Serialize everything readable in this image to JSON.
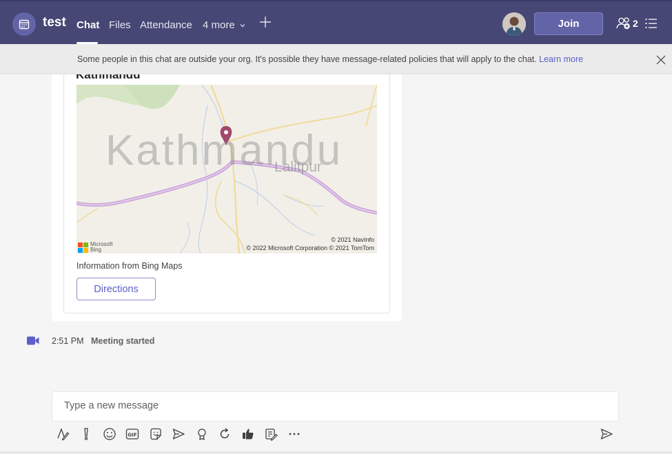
{
  "header": {
    "title": "test",
    "tabs": [
      {
        "label": "Chat"
      },
      {
        "label": "Files"
      },
      {
        "label": "Attendance"
      },
      {
        "label": "4 more"
      }
    ],
    "join_label": "Join",
    "participant_count": "2"
  },
  "banner": {
    "text": "Some people in this chat are outside your org. It's possible they have message-related policies that will apply to the chat.",
    "link": "Learn more"
  },
  "card": {
    "title": "Kathmandu",
    "map": {
      "city_label": "Kathmandu",
      "sub_label": "Lalitpur",
      "credit_line1": "© 2021 NavInfo",
      "credit_line2": "© 2022 Microsoft Corporation © 2021 TomTom",
      "logo_text_line1": "Microsoft",
      "logo_text_line2": "Bing"
    },
    "info": "Information from Bing Maps",
    "directions_label": "Directions"
  },
  "event": {
    "time": "2:51 PM",
    "text": "Meeting started"
  },
  "compose": {
    "placeholder": "Type a new message"
  },
  "colors": {
    "header_bg": "#464775",
    "accent": "#6264a7",
    "link": "#5b5fc7"
  }
}
